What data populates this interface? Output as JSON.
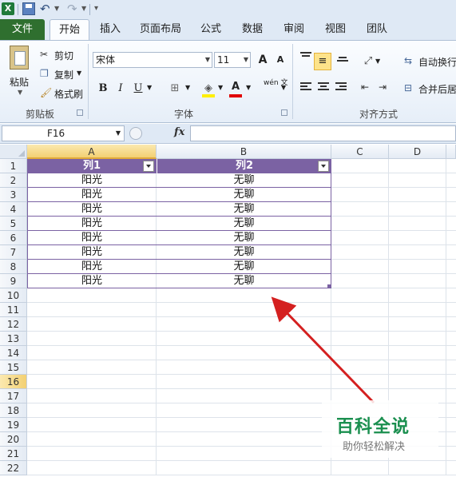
{
  "qat": {
    "logo": "X"
  },
  "tabs": [
    "文件",
    "开始",
    "插入",
    "页面布局",
    "公式",
    "数据",
    "审阅",
    "视图",
    "团队"
  ],
  "clipboard": {
    "paste": "粘贴",
    "cut": "剪切",
    "copy": "复制",
    "format_painter": "格式刷",
    "group_label": "剪贴板"
  },
  "font": {
    "name": "宋体",
    "size": "11",
    "bold": "B",
    "italic": "I",
    "underline": "U",
    "grow": "A",
    "shrink": "A",
    "font_color": "A",
    "wen": "wén 文",
    "group_label": "字体"
  },
  "alignment": {
    "wrap_text": "自动换行",
    "merge_center": "合并后居",
    "group_label": "对齐方式"
  },
  "formula_bar": {
    "name_box": "F16",
    "fx": "fx",
    "formula": ""
  },
  "columns": [
    "A",
    "B",
    "C",
    "D"
  ],
  "rows": [
    "1",
    "2",
    "3",
    "4",
    "5",
    "6",
    "7",
    "8",
    "9",
    "10",
    "11",
    "12",
    "13",
    "14",
    "15",
    "16",
    "17",
    "18",
    "19",
    "20",
    "21",
    "22"
  ],
  "selected_cell": "F16",
  "table": {
    "header_color": "#7b62a3",
    "headers": [
      "列1",
      "列2"
    ],
    "rows": [
      [
        "阳光",
        "无聊"
      ],
      [
        "阳光",
        "无聊"
      ],
      [
        "阳光",
        "无聊"
      ],
      [
        "阳光",
        "无聊"
      ],
      [
        "阳光",
        "无聊"
      ],
      [
        "阳光",
        "无聊"
      ],
      [
        "阳光",
        "无聊"
      ],
      [
        "阳光",
        "无聊"
      ]
    ]
  },
  "annotation": {
    "arrow_color": "#d42020"
  },
  "watermark": {
    "title": "百科全说",
    "subtitle": "助你轻松解决"
  }
}
